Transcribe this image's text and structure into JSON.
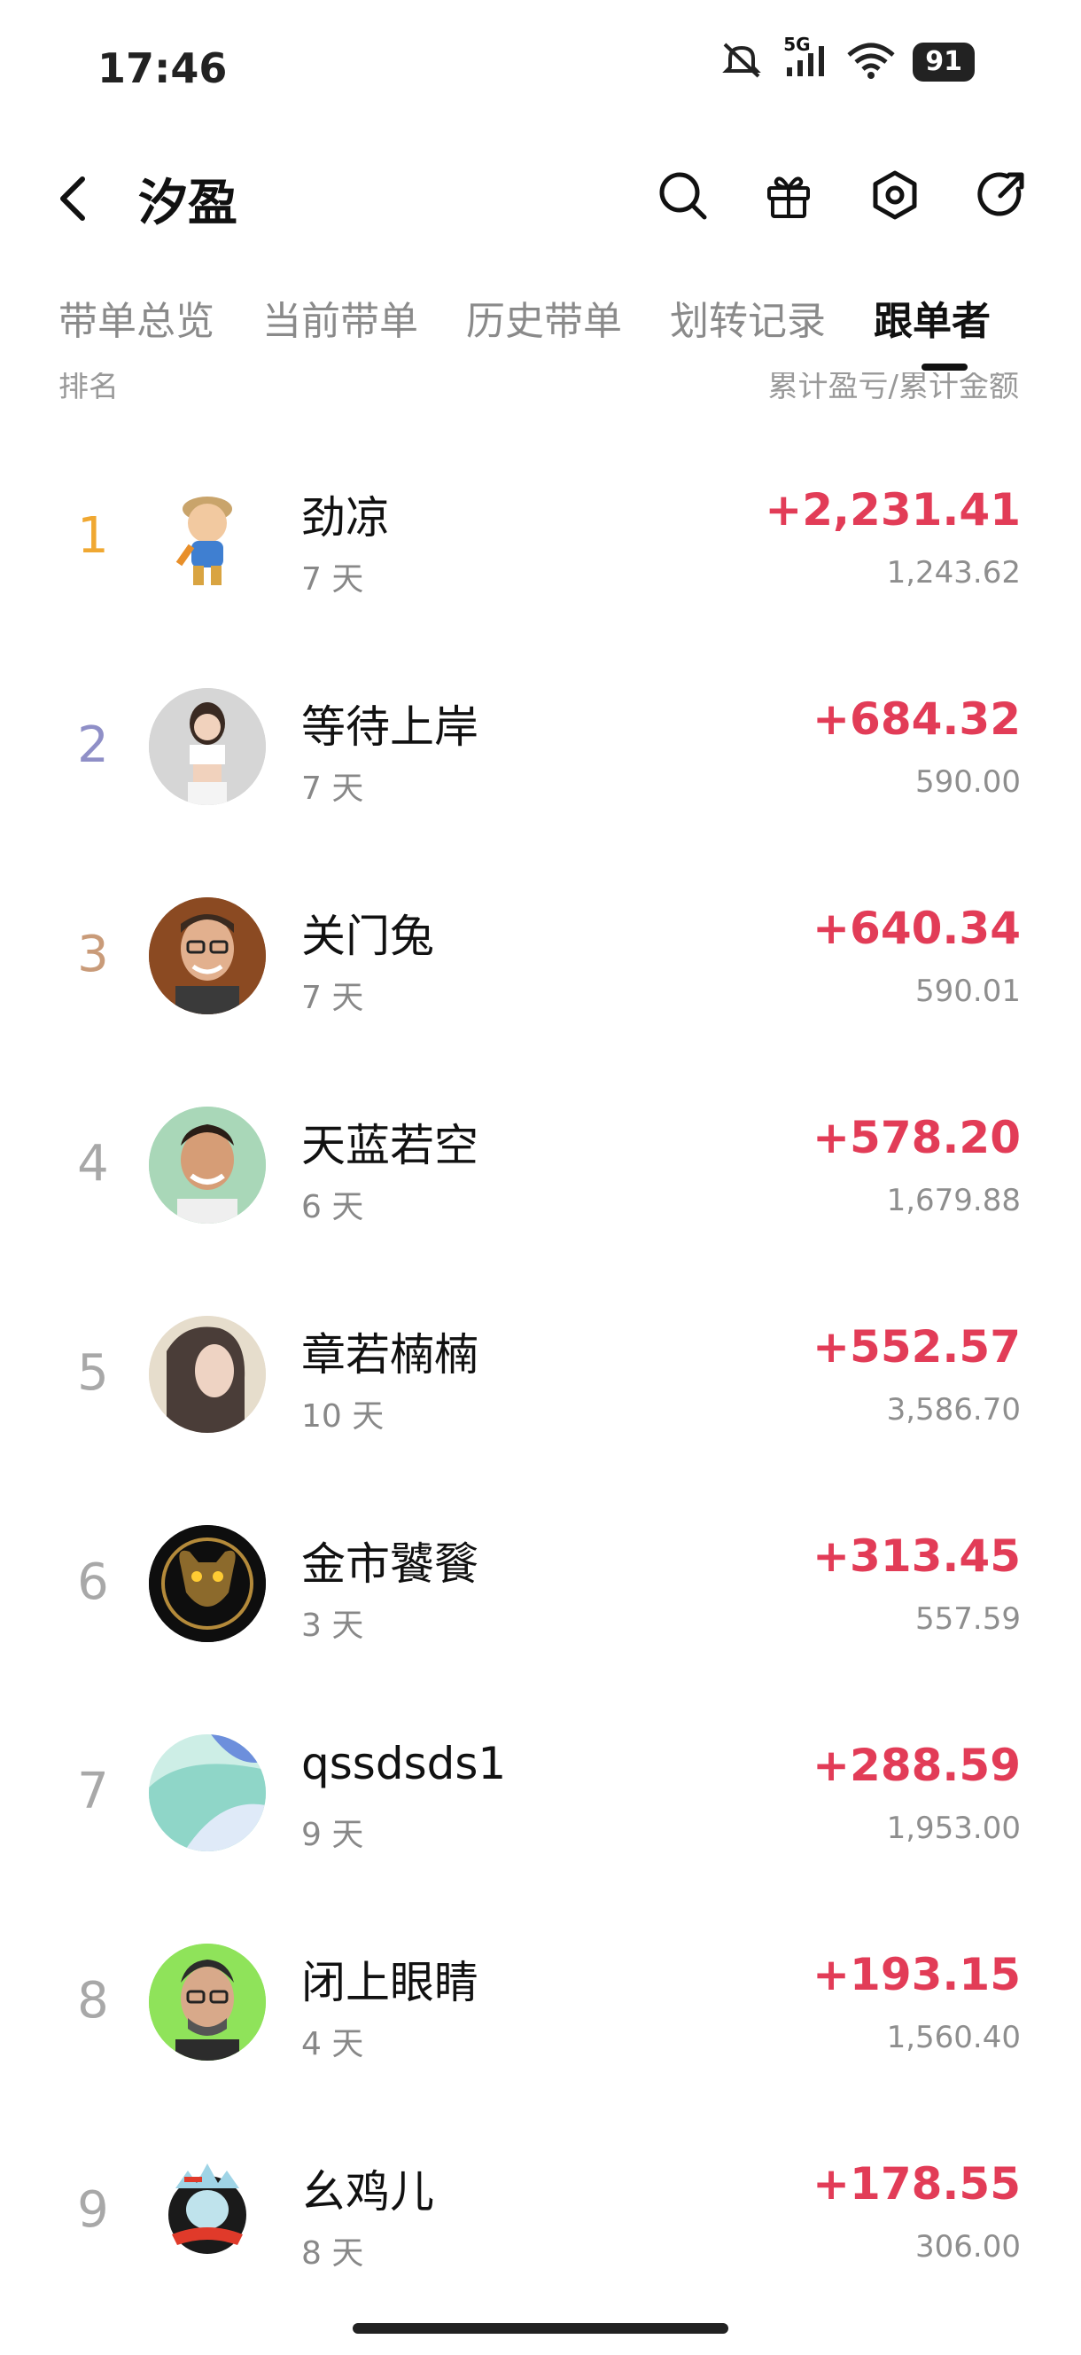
{
  "status_bar": {
    "time": "17:46",
    "network": "5G",
    "battery": "91"
  },
  "header": {
    "title": "汐盈"
  },
  "tabs": [
    {
      "label": "带单总览",
      "active": false
    },
    {
      "label": "当前带单",
      "active": false
    },
    {
      "label": "历史带单",
      "active": false
    },
    {
      "label": "划转记录",
      "active": false
    },
    {
      "label": "跟单者",
      "active": true
    }
  ],
  "list_header": {
    "left": "排名",
    "right": "累计盈亏/累计金额"
  },
  "followers": [
    {
      "rank": "1",
      "name": "劲凉",
      "days": "7 天",
      "profit": "+2,231.41",
      "amount": "1,243.62",
      "rank_color": "#f0a832"
    },
    {
      "rank": "2",
      "name": "等待上岸",
      "days": "7 天",
      "profit": "+684.32",
      "amount": "590.00",
      "rank_color": "#8f8fc7"
    },
    {
      "rank": "3",
      "name": "关门兔",
      "days": "7 天",
      "profit": "+640.34",
      "amount": "590.01",
      "rank_color": "#c99b79"
    },
    {
      "rank": "4",
      "name": "天蓝若空",
      "days": "6 天",
      "profit": "+578.20",
      "amount": "1,679.88",
      "rank_color": "#a8a8a8"
    },
    {
      "rank": "5",
      "name": "章若楠楠",
      "days": "10 天",
      "profit": "+552.57",
      "amount": "3,586.70",
      "rank_color": "#a8a8a8"
    },
    {
      "rank": "6",
      "name": "金市饕餮",
      "days": "3 天",
      "profit": "+313.45",
      "amount": "557.59",
      "rank_color": "#a8a8a8"
    },
    {
      "rank": "7",
      "name": "qssdsds1",
      "days": "9 天",
      "profit": "+288.59",
      "amount": "1,953.00",
      "rank_color": "#a8a8a8"
    },
    {
      "rank": "8",
      "name": "闭上眼睛",
      "days": "4 天",
      "profit": "+193.15",
      "amount": "1,560.40",
      "rank_color": "#a8a8a8"
    },
    {
      "rank": "9",
      "name": "幺鸡儿",
      "days": "8 天",
      "profit": "+178.55",
      "amount": "306.00",
      "rank_color": "#a8a8a8"
    }
  ],
  "icons": [
    "back-icon",
    "search-icon",
    "gift-icon",
    "settings-icon",
    "share-icon"
  ],
  "colors": {
    "profit": "#e23c57",
    "active_tab": "#111111",
    "inactive_tab": "#8a8a8a"
  }
}
